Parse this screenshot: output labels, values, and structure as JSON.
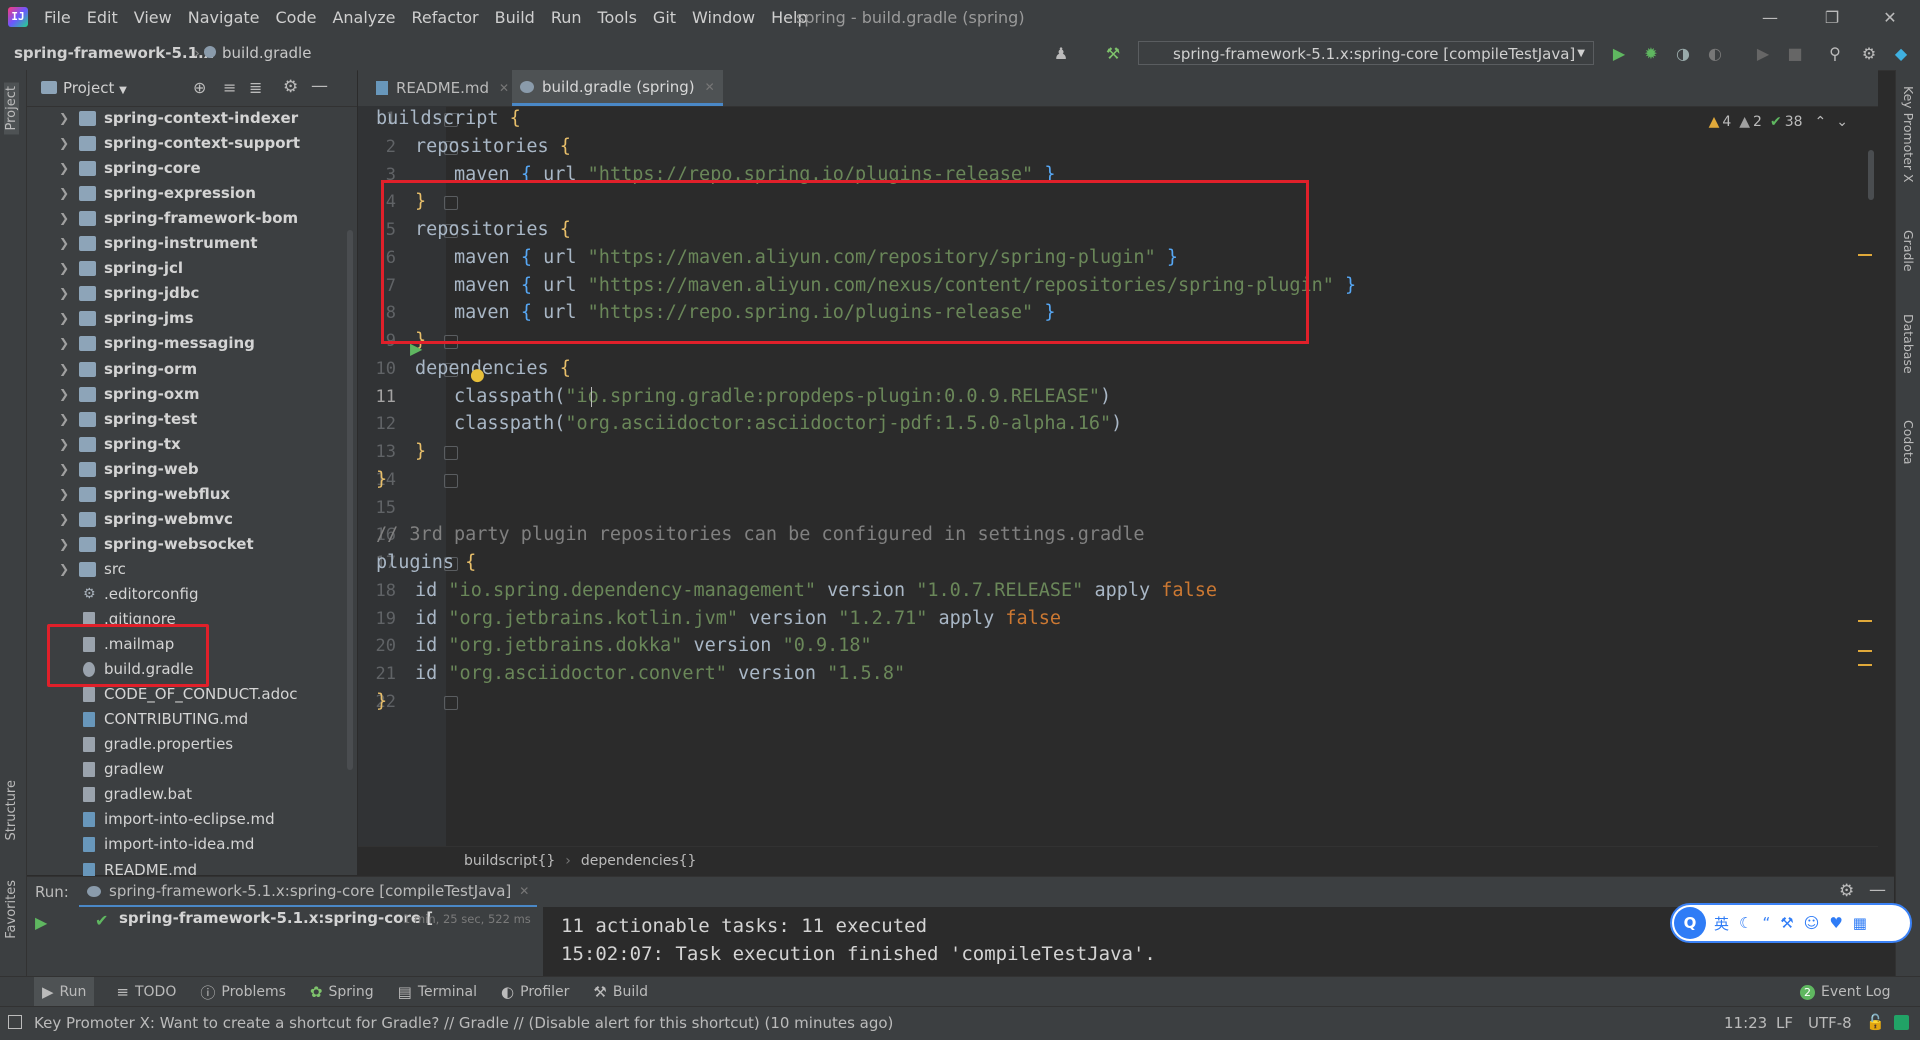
{
  "menu": {
    "app_logo": "IJ",
    "items": [
      "File",
      "Edit",
      "View",
      "Navigate",
      "Code",
      "Analyze",
      "Refactor",
      "Build",
      "Run",
      "Tools",
      "Git",
      "Window",
      "Help"
    ],
    "window_title": "spring - build.gradle (spring)"
  },
  "navbar": {
    "root": "spring-framework-5.1.x",
    "file": "build.gradle",
    "run_config": "spring-framework-5.1.x:spring-core [compileTestJava]"
  },
  "left_stripe": {
    "project": "Project",
    "structure": "Structure",
    "favorites": "Favorites"
  },
  "project": {
    "title": "Project",
    "tree": [
      {
        "label": "spring-context-indexer",
        "type": "module"
      },
      {
        "label": "spring-context-support",
        "type": "module"
      },
      {
        "label": "spring-core",
        "type": "module"
      },
      {
        "label": "spring-expression",
        "type": "module"
      },
      {
        "label": "spring-framework-bom",
        "type": "module"
      },
      {
        "label": "spring-instrument",
        "type": "module"
      },
      {
        "label": "spring-jcl",
        "type": "module"
      },
      {
        "label": "spring-jdbc",
        "type": "module"
      },
      {
        "label": "spring-jms",
        "type": "module"
      },
      {
        "label": "spring-messaging",
        "type": "module"
      },
      {
        "label": "spring-orm",
        "type": "module"
      },
      {
        "label": "spring-oxm",
        "type": "module"
      },
      {
        "label": "spring-test",
        "type": "module"
      },
      {
        "label": "spring-tx",
        "type": "module"
      },
      {
        "label": "spring-web",
        "type": "module"
      },
      {
        "label": "spring-webflux",
        "type": "module"
      },
      {
        "label": "spring-webmvc",
        "type": "module"
      },
      {
        "label": "spring-websocket",
        "type": "module"
      },
      {
        "label": "src",
        "type": "folder"
      },
      {
        "label": ".editorconfig",
        "type": "config"
      },
      {
        "label": ".gitignore",
        "type": "file"
      },
      {
        "label": ".mailmap",
        "type": "file"
      },
      {
        "label": "build.gradle",
        "type": "gradle"
      },
      {
        "label": "CODE_OF_CONDUCT.adoc",
        "type": "file"
      },
      {
        "label": "CONTRIBUTING.md",
        "type": "md"
      },
      {
        "label": "gradle.properties",
        "type": "file"
      },
      {
        "label": "gradlew",
        "type": "file"
      },
      {
        "label": "gradlew.bat",
        "type": "file"
      },
      {
        "label": "import-into-eclipse.md",
        "type": "md"
      },
      {
        "label": "import-into-idea.md",
        "type": "md"
      },
      {
        "label": "README.md",
        "type": "md"
      }
    ]
  },
  "editor": {
    "tabs": [
      {
        "label": "README.md",
        "active": false
      },
      {
        "label": "build.gradle (spring)",
        "active": true
      }
    ],
    "inspection": {
      "warnings": "4",
      "weak_warnings": "2",
      "ok": "38"
    },
    "current_line": "11",
    "lines": [
      {
        "n": "1",
        "indent": 0,
        "tokens": [
          [
            "id",
            "buildscript "
          ],
          [
            "brc",
            "{"
          ]
        ]
      },
      {
        "n": "2",
        "indent": 1,
        "tokens": [
          [
            "id",
            "repositories "
          ],
          [
            "brc",
            "{"
          ]
        ]
      },
      {
        "n": "3",
        "indent": 2,
        "tokens": [
          [
            "id",
            "maven "
          ],
          [
            "brb",
            "{ "
          ],
          [
            "id",
            "url "
          ],
          [
            "str",
            "\"https://repo.spring.io/plugins-release\""
          ],
          [
            "brb",
            " }"
          ]
        ]
      },
      {
        "n": "4",
        "indent": 1,
        "tokens": [
          [
            "brc",
            "}"
          ]
        ]
      },
      {
        "n": "5",
        "indent": 1,
        "tokens": [
          [
            "id",
            "repositories "
          ],
          [
            "brc",
            "{"
          ]
        ]
      },
      {
        "n": "6",
        "indent": 2,
        "tokens": [
          [
            "id",
            "maven "
          ],
          [
            "brb",
            "{ "
          ],
          [
            "id",
            "url "
          ],
          [
            "str",
            "\"https://maven.aliyun.com/repository/spring-plugin\""
          ],
          [
            "brb",
            " }"
          ]
        ]
      },
      {
        "n": "7",
        "indent": 2,
        "tokens": [
          [
            "id",
            "maven "
          ],
          [
            "brb",
            "{ "
          ],
          [
            "id",
            "url "
          ],
          [
            "str",
            "\"https://maven.aliyun.com/nexus/content/repositories/spring-plugin\""
          ],
          [
            "brb",
            " }"
          ]
        ]
      },
      {
        "n": "8",
        "indent": 2,
        "tokens": [
          [
            "id",
            "maven "
          ],
          [
            "brb",
            "{ "
          ],
          [
            "id",
            "url "
          ],
          [
            "str",
            "\"https://repo.spring.io/plugins-release\""
          ],
          [
            "brb",
            " }"
          ]
        ]
      },
      {
        "n": "9",
        "indent": 1,
        "tokens": [
          [
            "brc",
            "}"
          ]
        ]
      },
      {
        "n": "10",
        "indent": 1,
        "tokens": [
          [
            "id",
            "dependencies "
          ],
          [
            "brc",
            "{"
          ]
        ]
      },
      {
        "n": "11",
        "indent": 2,
        "tokens": [
          [
            "id",
            "classpath("
          ],
          [
            "str",
            "\"io.spring.gradle:propdeps-plugin:0.0.9.RELEASE\""
          ],
          [
            "id",
            ")"
          ]
        ]
      },
      {
        "n": "12",
        "indent": 2,
        "tokens": [
          [
            "id",
            "classpath("
          ],
          [
            "str",
            "\"org.asciidoctor:asciidoctorj-pdf:1.5.0-alpha.16\""
          ],
          [
            "id",
            ")"
          ]
        ]
      },
      {
        "n": "13",
        "indent": 1,
        "tokens": [
          [
            "brc",
            "}"
          ]
        ]
      },
      {
        "n": "14",
        "indent": 0,
        "tokens": [
          [
            "brc",
            "}"
          ]
        ]
      },
      {
        "n": "15",
        "indent": 0,
        "tokens": []
      },
      {
        "n": "16",
        "indent": 0,
        "tokens": [
          [
            "cmt",
            "// 3rd party plugin repositories can be configured in settings.gradle"
          ]
        ]
      },
      {
        "n": "17",
        "indent": 0,
        "tokens": [
          [
            "id",
            "plugins "
          ],
          [
            "brc",
            "{"
          ]
        ]
      },
      {
        "n": "18",
        "indent": 1,
        "tokens": [
          [
            "id",
            "id "
          ],
          [
            "str",
            "\"io.spring.dependency-management\""
          ],
          [
            "id",
            " version "
          ],
          [
            "str",
            "\"1.0.7.RELEASE\""
          ],
          [
            "id",
            " apply "
          ],
          [
            "kw",
            "false"
          ]
        ]
      },
      {
        "n": "19",
        "indent": 1,
        "tokens": [
          [
            "id",
            "id "
          ],
          [
            "str",
            "\"org.jetbrains.kotlin.jvm\""
          ],
          [
            "id",
            " version "
          ],
          [
            "str",
            "\"1.2.71\""
          ],
          [
            "id",
            " apply "
          ],
          [
            "kw",
            "false"
          ]
        ]
      },
      {
        "n": "20",
        "indent": 1,
        "tokens": [
          [
            "id",
            "id "
          ],
          [
            "str",
            "\"org.jetbrains.dokka\""
          ],
          [
            "id",
            " version "
          ],
          [
            "str",
            "\"0.9.18\""
          ]
        ]
      },
      {
        "n": "21",
        "indent": 1,
        "tokens": [
          [
            "id",
            "id "
          ],
          [
            "str",
            "\"org.asciidoctor.convert\""
          ],
          [
            "id",
            " version "
          ],
          [
            "str",
            "\"1.5.8\""
          ]
        ]
      },
      {
        "n": "22",
        "indent": 0,
        "tokens": [
          [
            "brc",
            "}"
          ]
        ]
      }
    ],
    "breadcrumb": [
      "buildscript{}",
      "dependencies{}"
    ]
  },
  "right_stripe": [
    "Key Promoter X",
    "Gradle",
    "Database",
    "Codota"
  ],
  "run": {
    "label": "Run:",
    "tab": "spring-framework-5.1.x:spring-core [compileTestJava]",
    "task": "spring-framework-5.1.x:spring-core [",
    "duration": "1 min, 25 sec, 522 ms",
    "console": [
      "11 actionable tasks: 11 executed",
      "15:02:07: Task execution finished 'compileTestJava'."
    ]
  },
  "tool_windows": [
    "Run",
    "TODO",
    "Problems",
    "Spring",
    "Terminal",
    "Profiler",
    "Build"
  ],
  "event_log": "Event Log",
  "event_count": "2",
  "status": {
    "message": "Key Promoter X: Want to create a shortcut for Gradle? // Gradle // (Disable alert for this shortcut) (10 minutes ago)",
    "position": "11:23",
    "line_sep": "LF",
    "encoding": "UTF-8"
  },
  "ime": {
    "lang": "英"
  }
}
